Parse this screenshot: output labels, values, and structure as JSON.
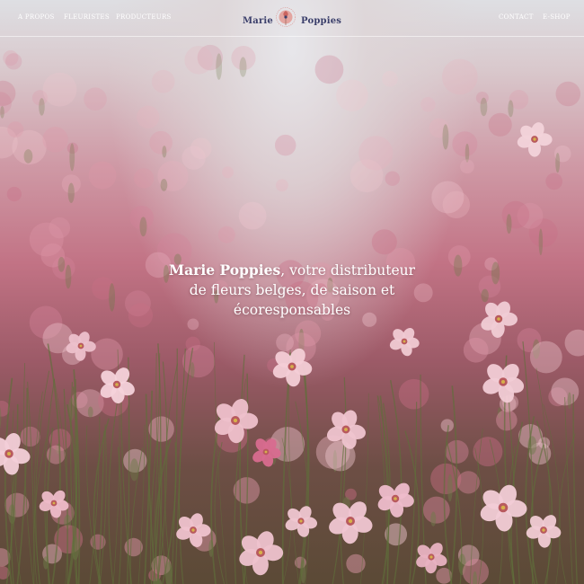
{
  "nav": {
    "left": [
      "A PROPOS",
      "FLEURISTES",
      "PRODUCTEURS"
    ],
    "right": [
      "CONTACT",
      "E-SHOP"
    ]
  },
  "logo": {
    "word1": "Marie",
    "word2": "Poppies",
    "color": "#3b3f6b",
    "emblem_color": "#d98a86",
    "emblem_icon": "poppy-flower-emblem"
  },
  "hero": {
    "brand": "Marie Poppies",
    "line1_rest": ", votre distributeur",
    "line2": "de fleurs belges, de saison et",
    "line3": "écoresponsables",
    "image": "pink-flower-field-photo"
  }
}
